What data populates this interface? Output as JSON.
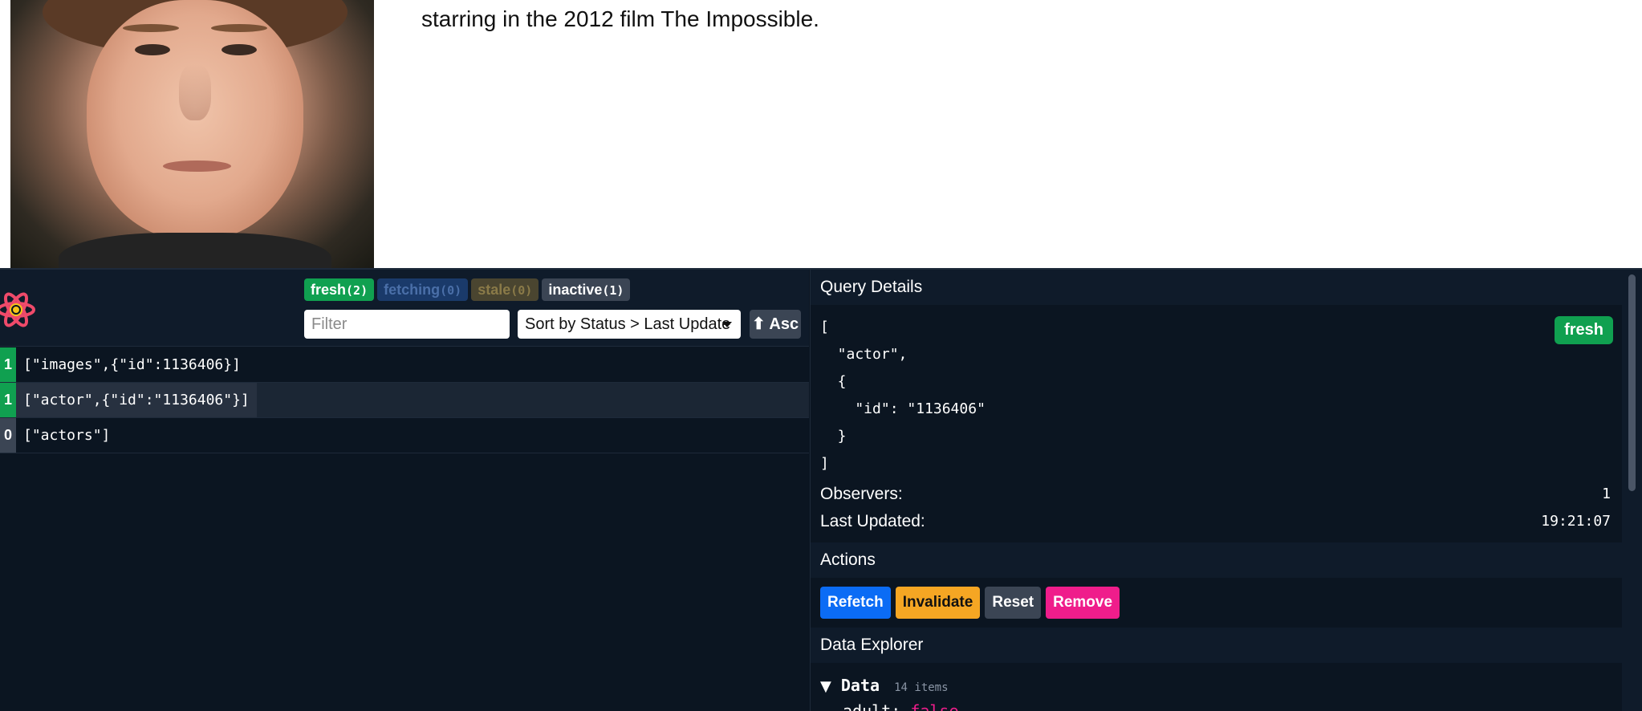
{
  "page": {
    "bio_text": "starring in the 2012 film The Impossible."
  },
  "devtools": {
    "status_badges": [
      {
        "label": "fresh",
        "count": "(2)"
      },
      {
        "label": "fetching",
        "count": "(0)"
      },
      {
        "label": "stale",
        "count": "(0)"
      },
      {
        "label": "inactive",
        "count": "(1)"
      }
    ],
    "filter_placeholder": "Filter",
    "sort_label": "Sort by Status > Last Update",
    "asc_label": "⬆ Asc",
    "queries": [
      {
        "observers": "1",
        "key": "[\"images\",{\"id\":1136406}]",
        "status_color": "#10a050"
      },
      {
        "observers": "1",
        "key": "[\"actor\",{\"id\":\"1136406\"}]",
        "status_color": "#10a050"
      },
      {
        "observers": "0",
        "key": "[\"actors\"]",
        "status_color": "#3b4554"
      }
    ],
    "details": {
      "header": "Query Details",
      "query_key_pretty": "[\n  \"actor\",\n  {\n    \"id\": \"1136406\"\n  }\n]",
      "status_pill": "fresh",
      "observers_label": "Observers:",
      "observers_value": "1",
      "last_updated_label": "Last Updated:",
      "last_updated_value": "19:21:07"
    },
    "actions": {
      "header": "Actions",
      "refetch": "Refetch",
      "invalidate": "Invalidate",
      "reset": "Reset",
      "remove": "Remove"
    },
    "explorer": {
      "header": "Data Explorer",
      "root_label": "Data",
      "item_count": "14 items",
      "first_child_key": "adult",
      "first_child_value": "false"
    }
  }
}
